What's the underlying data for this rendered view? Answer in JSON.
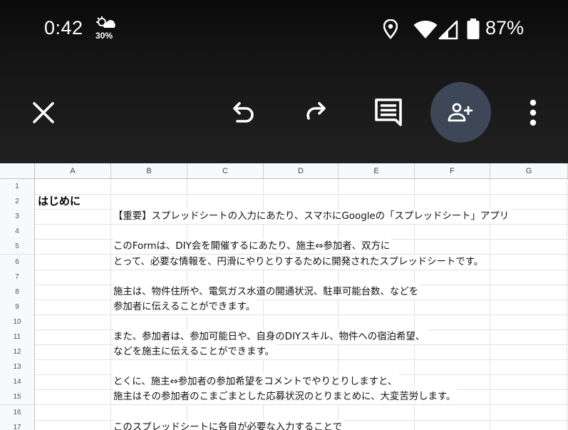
{
  "status_bar": {
    "time": "0:42",
    "weather_temp": "30%",
    "battery": "87%",
    "icons": [
      "weather-icon",
      "location-icon",
      "wifi-icon",
      "signal-icon",
      "battery-icon"
    ]
  },
  "toolbar": {
    "icons": [
      "close-icon",
      "undo-icon",
      "redo-icon",
      "comment-icon",
      "share-person-add-icon",
      "more-vert-icon"
    ],
    "colors": {
      "bar": "#1a1a1a",
      "share_circle": "#3d4757",
      "icon": "#ffffff"
    }
  },
  "sheet": {
    "columns": [
      "A",
      "B",
      "C",
      "D",
      "E",
      "F",
      "G"
    ],
    "rows": [
      {
        "num": "1",
        "a": "",
        "b": ""
      },
      {
        "num": "2",
        "a": "はじめに",
        "b": ""
      },
      {
        "num": "3",
        "a": "",
        "b": "【重要】スプレッドシートの入力にあたり、スマホにGoogleの「スプレッドシート」アプリ"
      },
      {
        "num": "4",
        "a": "",
        "b": ""
      },
      {
        "num": "5",
        "a": "",
        "b": "このFormは、DIY会を開催するにあたり、施主⇔参加者、双方に"
      },
      {
        "num": "6",
        "a": "",
        "b": "とって、必要な情報を、円滑にやりとりするために開発されたスプレッドシートです。"
      },
      {
        "num": "7",
        "a": "",
        "b": ""
      },
      {
        "num": "8",
        "a": "",
        "b": "施主は、物件住所や、電気ガス水道の開通状況、駐車可能台数、などを"
      },
      {
        "num": "9",
        "a": "",
        "b": "参加者に伝えることができます。"
      },
      {
        "num": "10",
        "a": "",
        "b": ""
      },
      {
        "num": "11",
        "a": "",
        "b": "また、参加者は、参加可能日や、自身のDIYスキル、物件への宿泊希望、"
      },
      {
        "num": "12",
        "a": "",
        "b": "などを施主に伝えることができます。"
      },
      {
        "num": "13",
        "a": "",
        "b": ""
      },
      {
        "num": "14",
        "a": "",
        "b": "とくに、施主⇔参加者の参加希望をコメントでやりとりしますと、"
      },
      {
        "num": "15",
        "a": "",
        "b": "施主はその参加者のこまごまとした応募状況のとりまとめに、大変苦労します。"
      },
      {
        "num": "16",
        "a": "",
        "b": ""
      },
      {
        "num": "17",
        "a": "",
        "b": "このスプレッドシートに各自が必要な入力することで"
      }
    ]
  }
}
